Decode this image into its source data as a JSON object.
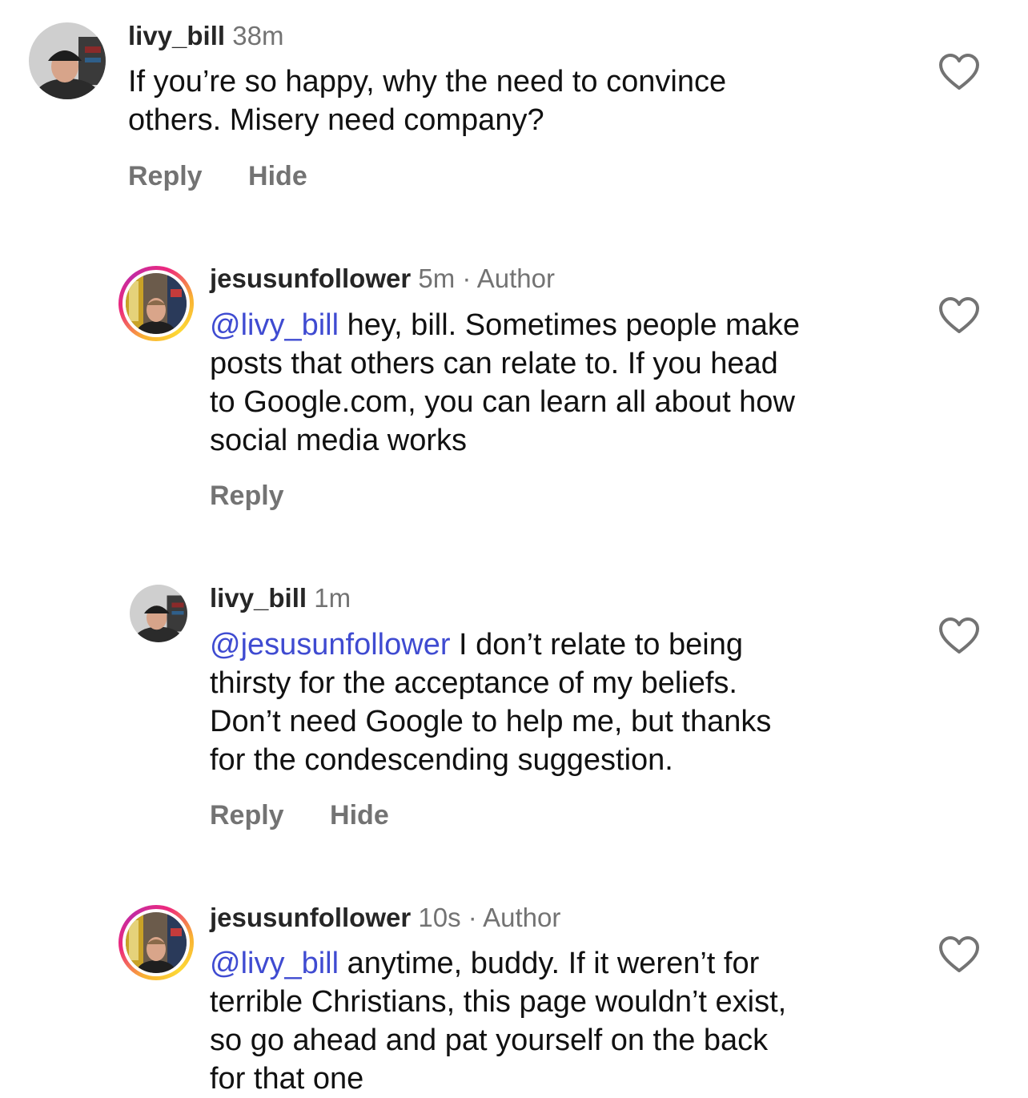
{
  "comments": [
    {
      "username": "livy_bill",
      "time": "38m",
      "author_tag": "",
      "mention": "",
      "text": "If you’re so happy, why the need to  convince\nothers. Misery need company?",
      "reply_label": "Reply",
      "hide_label": "Hide"
    },
    {
      "username": "jesusunfollower",
      "time": "5m",
      "author_tag": "· Author",
      "mention": "@livy_bill",
      "text": " hey, bill. Sometimes people make\nposts that others can relate to. If you head\nto Google.com, you can learn all about how\nsocial media works",
      "reply_label": "Reply",
      "hide_label": ""
    },
    {
      "username": "livy_bill",
      "time": "1m",
      "author_tag": "",
      "mention": "@jesusunfollower",
      "text": " I don’t relate to being\nthirsty for the acceptance of my beliefs.\nDon’t need Google to help me, but thanks\nfor the condescending suggestion.",
      "reply_label": "Reply",
      "hide_label": "Hide"
    },
    {
      "username": "jesusunfollower",
      "time": "10s",
      "author_tag": "· Author",
      "mention": "@livy_bill",
      "text": " anytime, buddy. If it weren’t for\nterrible Christians, this page wouldn’t exist,\nso go ahead and pat yourself on the back\nfor that one",
      "reply_label": "",
      "hide_label": ""
    }
  ],
  "icons": {
    "like": "heart-outline-icon",
    "avatar_bill": "user-photo-cap-man",
    "avatar_author": "user-photo-story-ring"
  },
  "colors": {
    "mention": "#3f4bd1",
    "secondary_text": "#737373",
    "story_ring_start": "#f9b233",
    "story_ring_end": "#ee2a7b"
  }
}
